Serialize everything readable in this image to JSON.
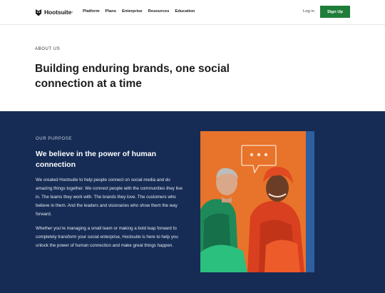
{
  "nav": {
    "logo_text": "Hootsuite",
    "logo_tm": "®",
    "links": [
      "Platform",
      "Plans",
      "Enterprise",
      "Resources",
      "Education"
    ],
    "login_label": "Log in",
    "signup_label": "Sign Up"
  },
  "hero": {
    "eyebrow": "ABOUT US",
    "title": "Building enduring brands, one social connection at a time"
  },
  "purpose": {
    "eyebrow": "OUR PURPOSE",
    "title": "We believe in the power of human connection",
    "body1": "We created Hootsuite to help people connect on social media and do amazing things together. We connect people with the communities they live in. The teams they work with. The brands they love. The customers who believe in them. And the leaders and visionaries who show them the way forward.",
    "body2": "Whether you’re managing a small team or making a bold leap forward to completely transform your social enterprise, Hootsuite is here to help you unlock the power of human connection and make great things happen."
  },
  "colors": {
    "nav_bg": "#ffffff",
    "signup_bg": "#1f7d3a",
    "purpose_bg": "#162c55",
    "photo_bg": "#e8732a",
    "photo_stripe": "#2e5fa0"
  },
  "icons": {
    "logo": "owl-icon",
    "speech_bubble": "chat-bubble-icon"
  }
}
